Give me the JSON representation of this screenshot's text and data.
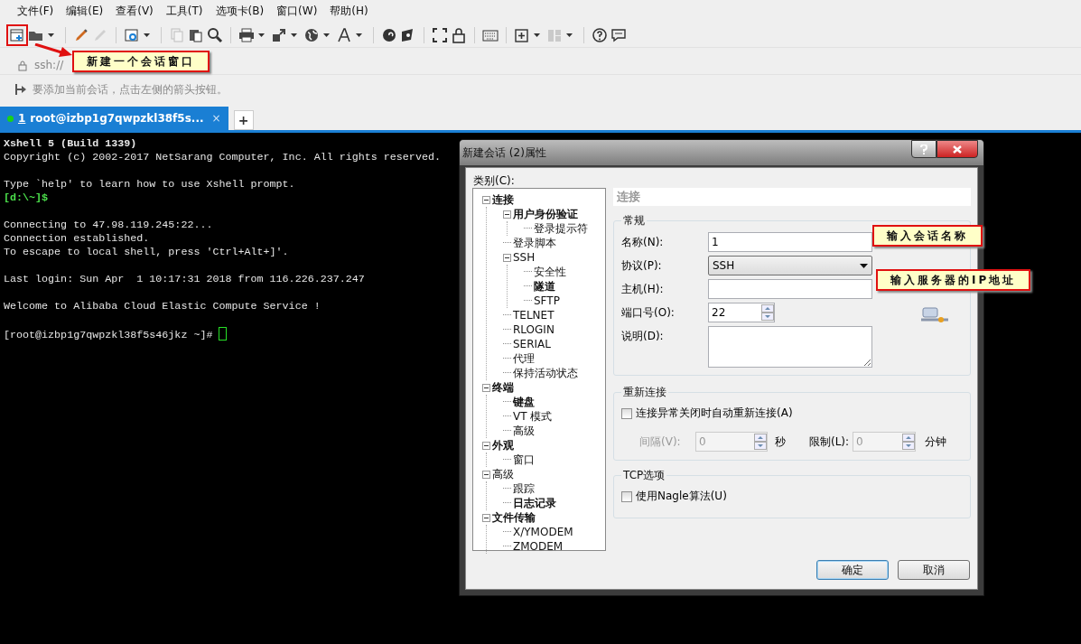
{
  "menu": [
    "文件(F)",
    "编辑(E)",
    "查看(V)",
    "工具(T)",
    "选项卡(B)",
    "窗口(W)",
    "帮助(H)"
  ],
  "address_bar": {
    "text": "ssh://"
  },
  "hint_bar": {
    "text": "要添加当前会话，点击左侧的箭头按钮。"
  },
  "tabs": [
    {
      "number": "1",
      "label": "root@izbp1g7qwpzkl38f5s...",
      "selected": true,
      "connected": true,
      "close": "×"
    }
  ],
  "new_tab": "+",
  "terminal": [
    {
      "kind": "bold",
      "text": "Xshell 5 (Build 1339)"
    },
    {
      "kind": "normal",
      "text": "Copyright (c) 2002-2017 NetSarang Computer, Inc. All rights reserved."
    },
    {
      "kind": "blank"
    },
    {
      "kind": "normal",
      "text": "Type `help' to learn how to use Xshell prompt."
    },
    {
      "kind": "prompt",
      "text": "[d:\\~]$"
    },
    {
      "kind": "blank"
    },
    {
      "kind": "normal",
      "text": "Connecting to 47.98.119.245:22..."
    },
    {
      "kind": "normal",
      "text": "Connection established."
    },
    {
      "kind": "normal",
      "text": "To escape to local shell, press 'Ctrl+Alt+]'."
    },
    {
      "kind": "blank"
    },
    {
      "kind": "normal",
      "text": "Last login: Sun Apr  1 10:17:31 2018 from 116.226.237.247"
    },
    {
      "kind": "blank"
    },
    {
      "kind": "normal",
      "text": "Welcome to Alibaba Cloud Elastic Compute Service !"
    },
    {
      "kind": "blank"
    },
    {
      "kind": "normal",
      "text": "[root@izbp1g7qwpzkl38f5s46jkz ~]# ",
      "cursor": true
    }
  ],
  "dialog": {
    "title": "新建会话 (2)属性",
    "category_label": "类别(C):",
    "tree": [
      {
        "label": "连接",
        "bold": true,
        "expanded": true,
        "children": [
          {
            "label": "用户身份验证",
            "bold": true,
            "expanded": true,
            "children": [
              {
                "label": "登录提示符",
                "bold": false
              }
            ]
          },
          {
            "label": "登录脚本",
            "bold": false
          },
          {
            "label": "SSH",
            "bold": false,
            "expanded": true,
            "children": [
              {
                "label": "安全性",
                "bold": false
              },
              {
                "label": "隧道",
                "bold": true
              },
              {
                "label": "SFTP",
                "bold": false
              }
            ]
          },
          {
            "label": "TELNET",
            "bold": false
          },
          {
            "label": "RLOGIN",
            "bold": false
          },
          {
            "label": "SERIAL",
            "bold": false
          },
          {
            "label": "代理",
            "bold": false
          },
          {
            "label": "保持活动状态",
            "bold": false
          }
        ]
      },
      {
        "label": "终端",
        "bold": true,
        "expanded": true,
        "children": [
          {
            "label": "键盘",
            "bold": true
          },
          {
            "label": "VT 模式",
            "bold": false
          },
          {
            "label": "高级",
            "bold": false
          }
        ]
      },
      {
        "label": "外观",
        "bold": true,
        "expanded": true,
        "children": [
          {
            "label": "窗口",
            "bold": false
          }
        ]
      },
      {
        "label": "高级",
        "bold": false,
        "expanded": true,
        "children": [
          {
            "label": "跟踪",
            "bold": false
          },
          {
            "label": "日志记录",
            "bold": true
          }
        ]
      },
      {
        "label": "文件传输",
        "bold": true,
        "expanded": true,
        "children": [
          {
            "label": "X/YMODEM",
            "bold": false
          },
          {
            "label": "ZMODEM",
            "bold": false
          }
        ]
      }
    ],
    "section_title": "连接",
    "general": {
      "title": "常规",
      "name_label": "名称(N):",
      "name_value": "1",
      "protocol_label": "协议(P):",
      "protocol_value": "SSH",
      "host_label": "主机(H):",
      "port_label": "端口号(O):",
      "port_value": "22",
      "description_label": "说明(D):"
    },
    "reconnect": {
      "title": "重新连接",
      "checkbox_label": "连接异常关闭时自动重新连接(A)",
      "checked": false,
      "interval_label": "间隔(V):",
      "interval_value": "0",
      "interval_unit": "秒",
      "limit_label": "限制(L):",
      "limit_value": "0",
      "limit_unit": "分钟"
    },
    "tcp": {
      "title": "TCP选项",
      "checkbox_label": "使用Nagle算法(U)",
      "checked": false
    },
    "buttons": [
      "确定",
      "取消"
    ]
  },
  "annotations": [
    {
      "text": "新建一个会话窗口"
    },
    {
      "text": "输入会话名称"
    },
    {
      "text": "输入服务器的IP地址"
    }
  ]
}
